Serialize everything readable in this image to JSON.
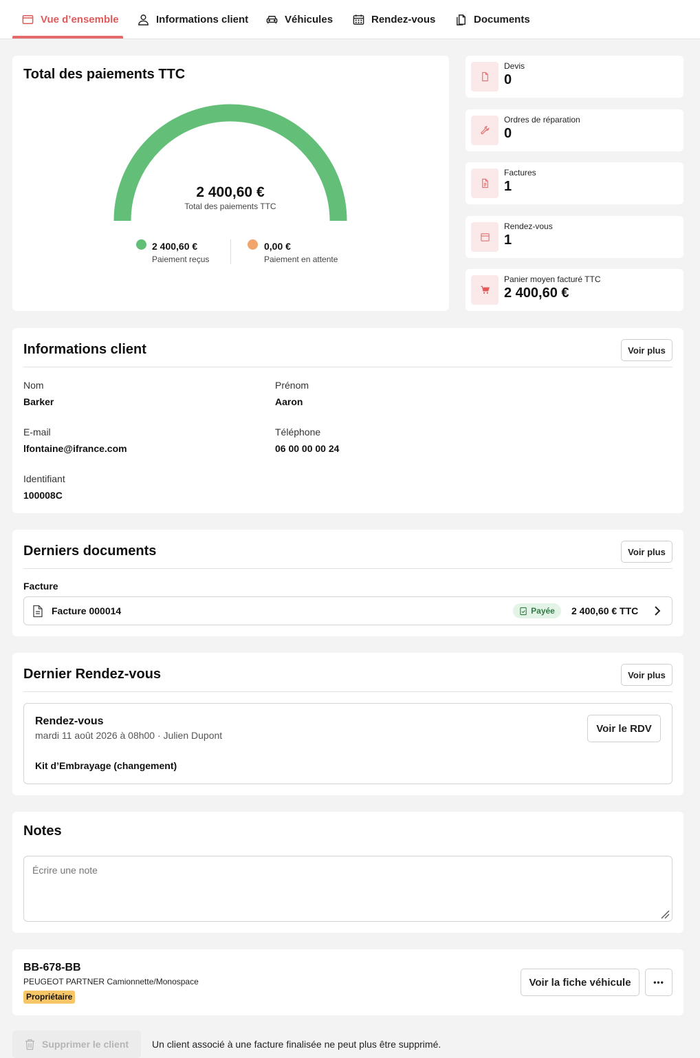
{
  "tabs": [
    {
      "label": "Vue d’ensemble",
      "icon": "card-icon",
      "active": true
    },
    {
      "label": "Informations client",
      "icon": "user-icon"
    },
    {
      "label": "Véhicules",
      "icon": "car-icon"
    },
    {
      "label": "Rendez-vous",
      "icon": "calendar-icon"
    },
    {
      "label": "Documents",
      "icon": "documents-icon"
    }
  ],
  "payments": {
    "title": "Total des paiements TTC",
    "total": "2 400,60 €",
    "total_label": "Total des paiements TTC",
    "received_fraction": 1.0,
    "received": {
      "value": "2 400,60 €",
      "label": "Paiement reçus",
      "color": "#63bf78"
    },
    "pending": {
      "value": "0,00 €",
      "label": "Paiement en attente",
      "color": "#f2a56a"
    }
  },
  "stats": [
    {
      "label": "Devis",
      "value": "0",
      "icon": "file-icon"
    },
    {
      "label": "Ordres de réparation",
      "value": "0",
      "icon": "wrench-icon"
    },
    {
      "label": "Factures",
      "value": "1",
      "icon": "invoice-icon"
    },
    {
      "label": "Rendez-vous",
      "value": "1",
      "icon": "calendar-icon"
    },
    {
      "label": "Panier moyen facturé TTC",
      "value": "2 400,60 €",
      "icon": "cart-icon"
    }
  ],
  "client_info": {
    "title": "Informations client",
    "more_label": "Voir plus",
    "fields": {
      "nom": {
        "label": "Nom",
        "value": "Barker"
      },
      "prenom": {
        "label": "Prénom",
        "value": "Aaron"
      },
      "email": {
        "label": "E-mail",
        "value": "lfontaine@ifrance.com"
      },
      "telephone": {
        "label": "Téléphone",
        "value": "06 00 00 00 24"
      },
      "identifiant": {
        "label": "Identifiant",
        "value": "100008C"
      }
    }
  },
  "documents": {
    "title": "Derniers documents",
    "more_label": "Voir plus",
    "group_label": "Facture",
    "item": {
      "name": "Facture 000014",
      "status": "Payée",
      "amount": "2 400,60 € TTC"
    }
  },
  "appointment": {
    "title": "Dernier Rendez-vous",
    "more_label": "Voir plus",
    "card_title": "Rendez-vous",
    "datetime": "mardi 11 août 2026 à 08h00 · Julien Dupont",
    "description": "Kit d’Embrayage (changement)",
    "view_label": "Voir le RDV"
  },
  "notes": {
    "title": "Notes",
    "placeholder": "Écrire une note"
  },
  "vehicle": {
    "plate": "BB-678-BB",
    "model": "PEUGEOT PARTNER Camionnette/Monospace",
    "badge": "Propriétaire",
    "view_label": "Voir la fiche véhicule",
    "more_label": "•••"
  },
  "footer": {
    "delete_label": "Supprimer le client",
    "notice": "Un client associé à une facture finalisée ne peut plus être supprimé."
  },
  "colors": {
    "accent": "#e05a5a",
    "green": "#63bf78",
    "orange": "#f2a56a",
    "badge_yellow": "#f7c667",
    "paid_green": "#e3f4e6"
  }
}
